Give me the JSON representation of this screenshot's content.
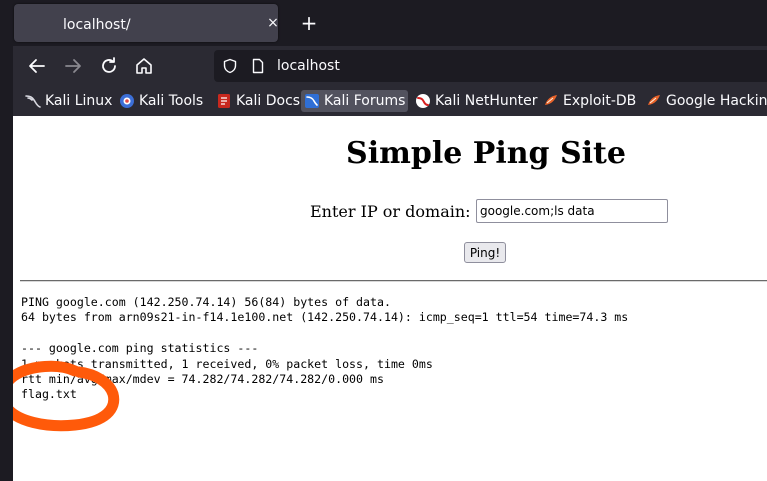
{
  "tab": {
    "title": "localhost/",
    "close_glyph": "×",
    "new_tab_glyph": "+"
  },
  "nav": {
    "back_icon": "arrow-left-icon",
    "forward_icon": "arrow-right-icon",
    "reload_icon": "reload-icon",
    "home_icon": "home-icon",
    "url": "localhost"
  },
  "bookmarks": [
    {
      "label": "Kali Linux",
      "icon": "kali-dragon-icon"
    },
    {
      "label": "Kali Tools",
      "icon": "kali-tools-icon"
    },
    {
      "label": "Kali Docs",
      "icon": "kali-docs-icon"
    },
    {
      "label": "Kali Forums",
      "icon": "kali-forums-icon",
      "active": true
    },
    {
      "label": "Kali NetHunter",
      "icon": "nethunter-icon"
    },
    {
      "label": "Exploit-DB",
      "icon": "exploit-db-icon"
    },
    {
      "label": "Google Hacking",
      "icon": "ghdb-icon"
    }
  ],
  "page": {
    "heading": "Simple Ping Site",
    "input_label": "Enter IP or domain:",
    "input_value": "google.com;ls data",
    "button_label": "Ping!",
    "output": [
      "PING google.com (142.250.74.14) 56(84) bytes of data.",
      "64 bytes from arn09s21-in-f14.1e100.net (142.250.74.14): icmp_seq=1 ttl=54 time=74.3 ms",
      "",
      "--- google.com ping statistics ---",
      "1 packets transmitted, 1 received, 0% packet loss, time 0ms",
      "rtt min/avg/max/mdev = 74.282/74.282/74.282/0.000 ms",
      "flag.txt"
    ]
  },
  "colors": {
    "chrome_dark": "#1c1b22",
    "toolbar": "#2b2a33",
    "tab_active": "#42414d",
    "annotation": "#ff5a0a"
  }
}
